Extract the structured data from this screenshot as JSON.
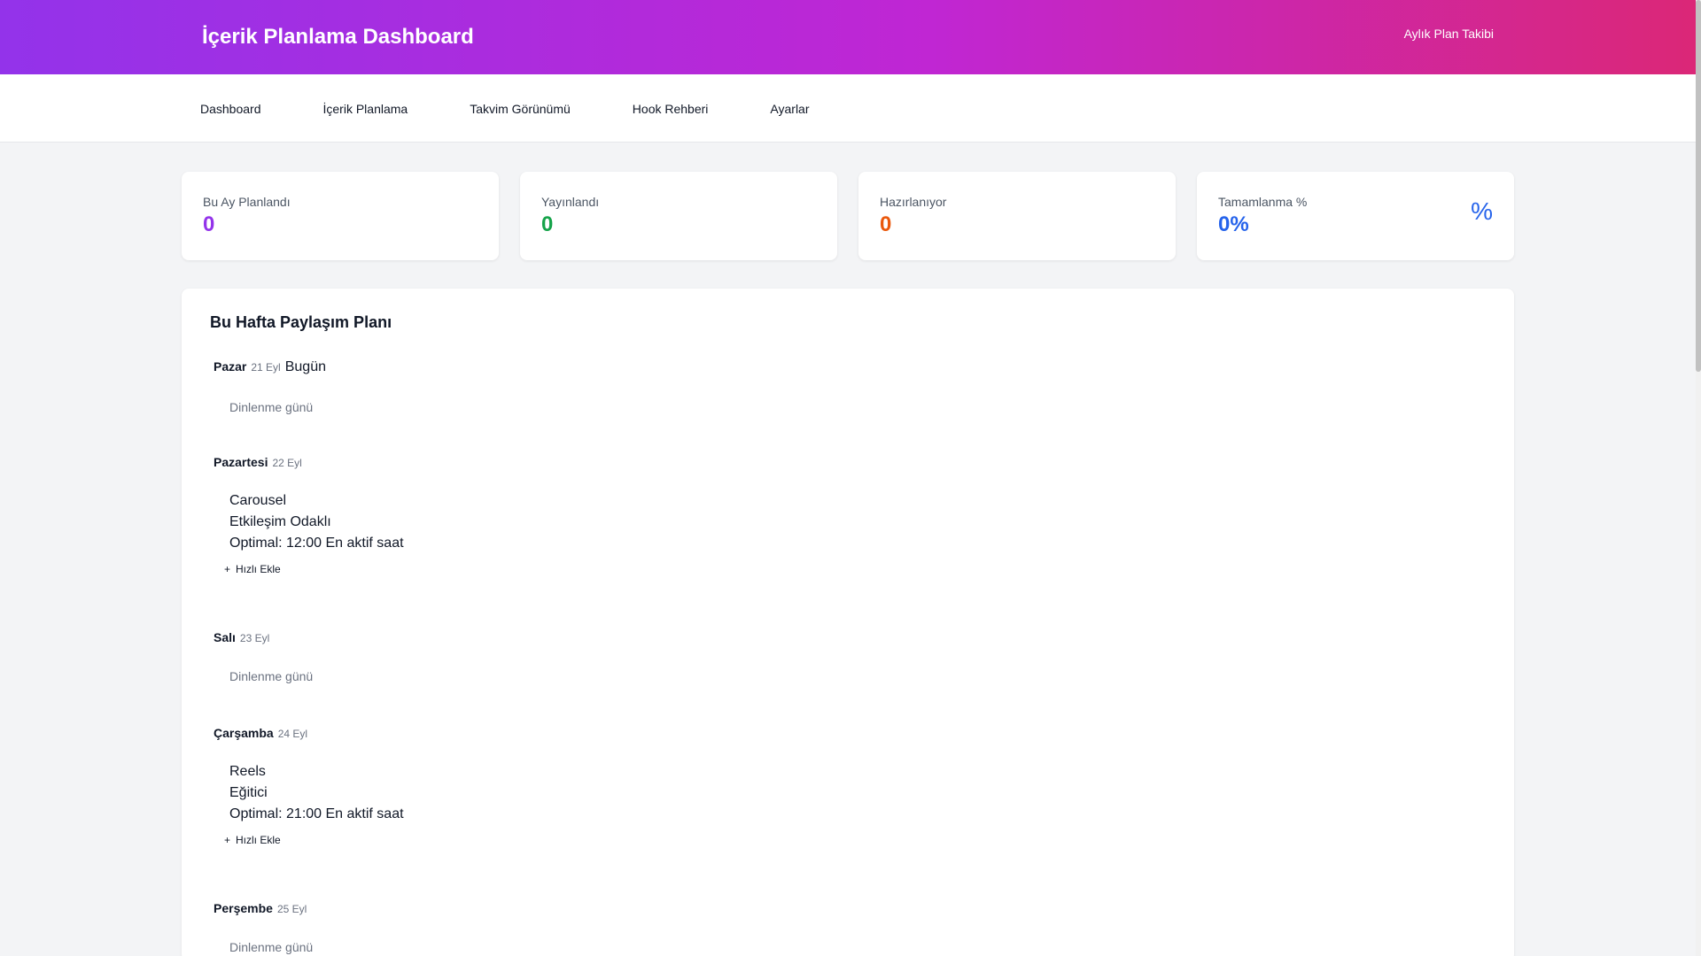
{
  "header": {
    "title_icon": "calendar-icon",
    "title": "İçerik Planlama Dashboard",
    "right_label": "Aylık Plan Takibi",
    "right_icon": "user-icon"
  },
  "nav": {
    "items": [
      {
        "label": "Dashboard",
        "icon": "home-icon"
      },
      {
        "label": "İçerik Planlama",
        "icon": "edit-icon"
      },
      {
        "label": "Takvim Görünümü",
        "icon": "calendar-icon"
      },
      {
        "label": "Hook Rehberi",
        "icon": "hook-icon"
      },
      {
        "label": "Ayarlar",
        "icon": "settings-icon"
      }
    ]
  },
  "stats": [
    {
      "label": "Bu Ay Planlandı",
      "value": "0",
      "color": "#9333ea",
      "icon": "calendar-icon"
    },
    {
      "label": "Yayınlandı",
      "value": "0",
      "color": "#16a34a",
      "icon": "check-icon"
    },
    {
      "label": "Hazırlanıyor",
      "value": "0",
      "color": "#ea580c",
      "icon": "clock-icon"
    },
    {
      "label": "Tamamlanma %",
      "value": "0%",
      "color": "#2563eb",
      "icon": "percent-icon",
      "icon_text": "%"
    }
  ],
  "plan": {
    "title": "Bu Hafta Paylaşım Planı",
    "days": [
      {
        "name": "Pazar",
        "date": "21 Eyl",
        "today": "Bugün",
        "rest": "Dinlenme günü"
      },
      {
        "name": "Pazartesi",
        "date": "22 Eyl",
        "format": "Carousel",
        "type": "Etkileşim Odaklı",
        "time": "Optimal: 12:00 En aktif saat",
        "quick_add": "Hızlı Ekle"
      },
      {
        "name": "Salı",
        "date": "23 Eyl",
        "rest": "Dinlenme günü"
      },
      {
        "name": "Çarşamba",
        "date": "24 Eyl",
        "format": "Reels",
        "type": "Eğitici",
        "time": "Optimal: 21:00 En aktif saat",
        "quick_add": "Hızlı Ekle"
      },
      {
        "name": "Perşembe",
        "date": "25 Eyl",
        "rest": "Dinlenme günü"
      }
    ]
  }
}
